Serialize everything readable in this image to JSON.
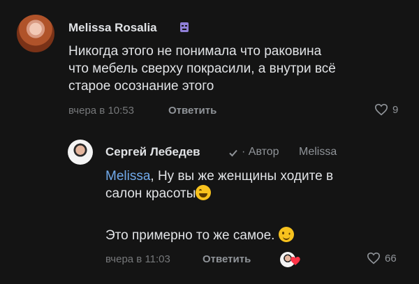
{
  "comments": [
    {
      "author": "Melissa Rosalia",
      "text": "Никогда этого не понимала что раковина\nчто мебель сверху покрасили, а внутри всё\nстарое осознание этого",
      "timestamp": "вчера в 10:53",
      "reply_label": "Ответить",
      "likes": "9",
      "icons": {
        "badge": "mask-badge-icon",
        "like": "heart-outline-icon"
      }
    },
    {
      "author": "Сергей Лебедев",
      "author_tag": "· Автор",
      "reply_to": "Melissa",
      "mention": "Melissa",
      "text_after_mention": ", Ну вы же женщины ходите в\nсалон красоты",
      "text_second": "Это примерно то же самое.",
      "timestamp": "вчера в 11:03",
      "reply_label": "Ответить",
      "likes": "66",
      "icons": {
        "verified": "check-icon",
        "laugh_emoji": "laughing-emoji-icon",
        "wink_emoji": "winking-emoji-icon",
        "like": "heart-outline-icon",
        "liker_heart": "red-heart-icon"
      }
    }
  ],
  "colors": {
    "background": "#141414",
    "text": "#e1e3e6",
    "muted": "#76787a",
    "link": "#71aaeb",
    "heart": "#ff3347"
  }
}
